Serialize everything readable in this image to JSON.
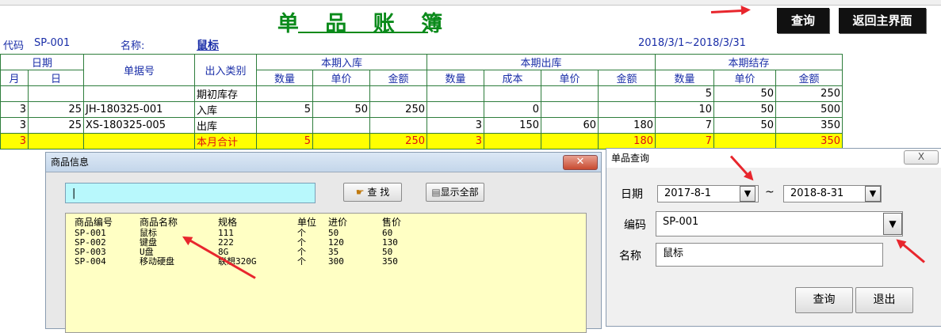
{
  "page_title": "单 品 账 簿",
  "buttons": {
    "query": "查询",
    "back_main": "返回主界面"
  },
  "info": {
    "code_label": "代码",
    "code_value": "SP-001",
    "name_label": "名称:",
    "name_value": "鼠标",
    "date_range": "2018/3/1~2018/3/31"
  },
  "ledger": {
    "headers": {
      "date": "日期",
      "month": "月",
      "day": "日",
      "doc_no": "单据号",
      "io_type": "出入类别",
      "in_group": "本期入库",
      "out_group": "本期出库",
      "bal_group": "本期结存",
      "qty": "数量",
      "price": "单价",
      "amount": "金额",
      "cost": "成本"
    },
    "rows": [
      {
        "m": "",
        "d": "",
        "no": "",
        "type": "期初库存",
        "in_q": "",
        "in_p": "",
        "in_a": "",
        "out_q": "",
        "out_c": "",
        "out_p": "",
        "out_a": "",
        "b_q": "5",
        "b_p": "50",
        "b_a": "250"
      },
      {
        "m": "3",
        "d": "25",
        "no": "JH-180325-001",
        "type": "入库",
        "in_q": "5",
        "in_p": "50",
        "in_a": "250",
        "out_q": "",
        "out_c": "0",
        "out_p": "",
        "out_a": "",
        "b_q": "10",
        "b_p": "50",
        "b_a": "500"
      },
      {
        "m": "3",
        "d": "25",
        "no": "XS-180325-005",
        "type": "出库",
        "in_q": "",
        "in_p": "",
        "in_a": "",
        "out_q": "3",
        "out_c": "150",
        "out_p": "60",
        "out_a": "180",
        "b_q": "7",
        "b_p": "50",
        "b_a": "350"
      },
      {
        "m": "3",
        "d": "",
        "no": "",
        "type": "本月合计",
        "in_q": "5",
        "in_p": "",
        "in_a": "250",
        "out_q": "3",
        "out_c": "",
        "out_p": "",
        "out_a": "180",
        "b_q": "7",
        "b_p": "",
        "b_a": "350"
      }
    ]
  },
  "product_dialog": {
    "title": "商品信息",
    "search_value": "|",
    "find_button": "查 找",
    "show_all_button": "显示全部",
    "columns": [
      "商品编号",
      "商品名称",
      "规格",
      "单位",
      "进价",
      "售价"
    ],
    "items": [
      [
        "SP-001",
        "鼠标",
        "111",
        "个",
        "50",
        "60"
      ],
      [
        "SP-002",
        "键盘",
        "222",
        "个",
        "120",
        "130"
      ],
      [
        "SP-003",
        "U盘",
        "8G",
        "个",
        "35",
        "50"
      ],
      [
        "SP-004",
        "移动硬盘",
        "联想320G",
        "个",
        "300",
        "350"
      ]
    ]
  },
  "query_dialog": {
    "title": "单品查询",
    "close_symbol": "X",
    "date_label": "日期",
    "date_from": "2017-8-1",
    "tilde": "~",
    "date_to": "2018-8-31",
    "code_label": "编码",
    "code_value": "SP-001",
    "name_label": "名称",
    "name_value": "鼠标",
    "query_button": "查询",
    "exit_button": "退出"
  },
  "icons": {
    "dropdown": "dropdown-arrow-icon",
    "find": "hand-pointer-icon",
    "show_all": "document-list-icon",
    "close": "close-icon"
  },
  "colors": {
    "title_green": "#0a8a1a",
    "header_blue": "#1a2ea8",
    "total_yellow": "#ffff00",
    "total_red": "#e01010",
    "arrow_red": "#e8262d"
  }
}
